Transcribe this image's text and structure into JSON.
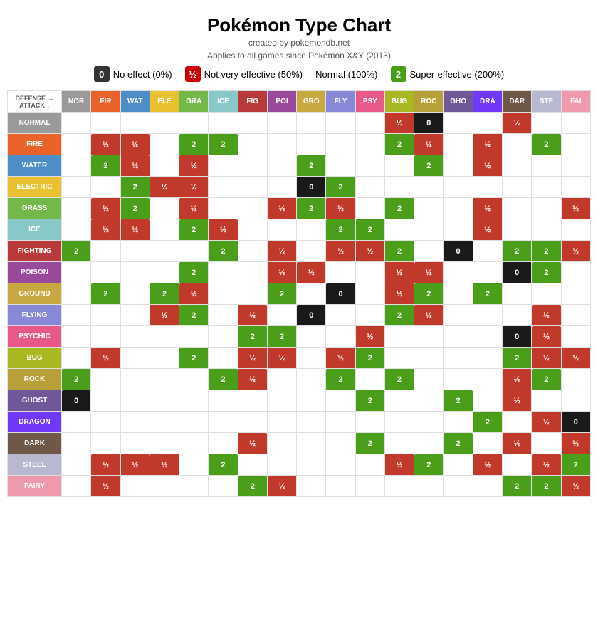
{
  "title": "Pokémon Type Chart",
  "subtitle1": "created by pokemondb.net",
  "subtitle2": "Applies to all games since Pokémon X&Y (2013)",
  "legend": [
    {
      "badge": "0",
      "style": "badge-black",
      "label": "No effect (0%)"
    },
    {
      "badge": "½",
      "style": "badge-red",
      "label": "Not very effective (50%)"
    },
    {
      "badge": "",
      "style": "",
      "label": "Normal (100%)"
    },
    {
      "badge": "2",
      "style": "badge-green",
      "label": "Super-effective (200%)"
    }
  ],
  "col_types": [
    "NOR",
    "FIR",
    "WAT",
    "ELE",
    "GRA",
    "ICE",
    "FIG",
    "POI",
    "GRO",
    "FLY",
    "PSY",
    "BUG",
    "ROC",
    "GHO",
    "DRA",
    "DAR",
    "STE",
    "FAI"
  ],
  "col_classes": [
    "type-normal",
    "type-fire",
    "type-water",
    "type-electric",
    "type-grass",
    "type-ice",
    "type-fighting",
    "type-poison",
    "type-ground",
    "type-flying",
    "type-psychic",
    "type-bug",
    "type-rock",
    "type-ghost",
    "type-dragon",
    "type-dark",
    "type-steel",
    "type-fairy"
  ],
  "row_types": [
    "NORMAL",
    "FIRE",
    "WATER",
    "ELECTRIC",
    "GRASS",
    "ICE",
    "FIGHTING",
    "POISON",
    "GROUND",
    "FLYING",
    "PSYCHIC",
    "BUG",
    "ROCK",
    "GHOST",
    "DRAGON",
    "DARK",
    "STEEL",
    "FAIRY"
  ],
  "row_classes": [
    "type-normal",
    "type-fire",
    "type-water",
    "type-electric",
    "type-grass",
    "type-ice",
    "type-fighting",
    "type-poison",
    "type-ground",
    "type-flying",
    "type-psychic",
    "type-bug",
    "type-rock",
    "type-ghost",
    "type-dragon",
    "type-dark",
    "type-steel",
    "type-fairy"
  ],
  "rows": [
    [
      "",
      "",
      "",
      "",
      "",
      "",
      "",
      "",
      "",
      "",
      "",
      "½",
      "0",
      "",
      "",
      "½",
      "",
      ""
    ],
    [
      "",
      "½",
      "½",
      "",
      "2",
      "2",
      "",
      "",
      "",
      "",
      "",
      "2",
      "½",
      "",
      "½",
      "",
      "2",
      ""
    ],
    [
      "",
      "2",
      "½",
      "",
      "½",
      "",
      "",
      "",
      "2",
      "",
      "",
      "",
      "2",
      "",
      "½",
      "",
      "",
      ""
    ],
    [
      "",
      "",
      "2",
      "½",
      "½",
      "",
      "",
      "",
      "0",
      "2",
      "",
      "",
      "",
      "",
      "",
      "",
      "",
      ""
    ],
    [
      "",
      "½",
      "2",
      "",
      "½",
      "",
      "",
      "½",
      "2",
      "½",
      "",
      "2",
      "",
      "",
      "½",
      "",
      "",
      "½"
    ],
    [
      "",
      "½",
      "½",
      "",
      "2",
      "½",
      "",
      "",
      "",
      "2",
      "2",
      "",
      "",
      "",
      "½",
      "",
      "",
      ""
    ],
    [
      "2",
      "",
      "",
      "",
      "",
      "2",
      "",
      "½",
      "",
      "½",
      "½",
      "2",
      "",
      "0",
      "",
      "2",
      "2",
      "½"
    ],
    [
      "",
      "",
      "",
      "",
      "2",
      "",
      "",
      "½",
      "½",
      "",
      "",
      "½",
      "½",
      "",
      "",
      "0",
      "2",
      ""
    ],
    [
      "",
      "2",
      "",
      "2",
      "½",
      "",
      "",
      "2",
      "",
      "0",
      "",
      "½",
      "2",
      "",
      "2",
      "",
      "",
      ""
    ],
    [
      "",
      "",
      "",
      "½",
      "2",
      "",
      "½",
      "",
      "0",
      "",
      "",
      "2",
      "½",
      "",
      "",
      "",
      "½",
      ""
    ],
    [
      "",
      "",
      "",
      "",
      "",
      "",
      "2",
      "2",
      "",
      "",
      "½",
      "",
      "",
      "",
      "",
      "0",
      "½",
      ""
    ],
    [
      "",
      "½",
      "",
      "",
      "2",
      "",
      "½",
      "½",
      "",
      "½",
      "2",
      "",
      "",
      "",
      "",
      "2",
      "½",
      "½"
    ],
    [
      "2",
      "",
      "",
      "",
      "",
      "2",
      "½",
      "",
      "",
      "2",
      "",
      "2",
      "",
      "",
      "",
      "½",
      "2",
      ""
    ],
    [
      "0",
      "",
      "",
      "",
      "",
      "",
      "",
      "",
      "",
      "",
      "2",
      "",
      "",
      "2",
      "",
      "½",
      "",
      ""
    ],
    [
      "",
      "",
      "",
      "",
      "",
      "",
      "",
      "",
      "",
      "",
      "",
      "",
      "",
      "",
      "2",
      "",
      "½",
      "0"
    ],
    [
      "",
      "",
      "",
      "",
      "",
      "",
      "½",
      "",
      "",
      "",
      "2",
      "",
      "",
      "2",
      "",
      "½",
      "",
      "½"
    ],
    [
      "",
      "½",
      "½",
      "½",
      "",
      "2",
      "",
      "",
      "",
      "",
      "",
      "½",
      "2",
      "",
      "½",
      "",
      "½",
      "2"
    ],
    [
      "",
      "½",
      "",
      "",
      "",
      "",
      "2",
      "½",
      "",
      "",
      "",
      "",
      "",
      "",
      "",
      "2",
      "2",
      "½"
    ]
  ],
  "corner_text": "DEFENSE →\nATTACK ↓"
}
